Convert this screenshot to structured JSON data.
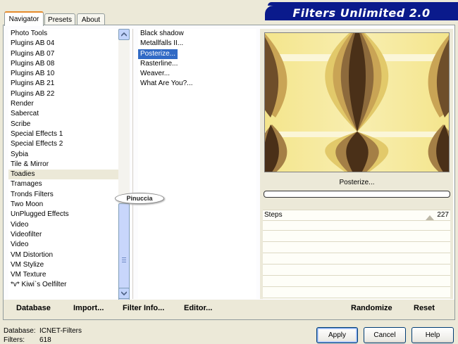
{
  "tabs": [
    "Navigator",
    "Presets",
    "About"
  ],
  "banner_title": "Filters Unlimited 2.0",
  "categories": [
    "Photo Tools",
    "Plugins AB 04",
    "Plugins AB 07",
    "Plugins AB 08",
    "Plugins AB 10",
    "Plugins AB 21",
    "Plugins AB 22",
    "Render",
    "Sabercat",
    "Scribe",
    "Special Effects 1",
    "Special Effects 2",
    "Sybia",
    "Tile & Mirror",
    "Toadies",
    "Tramages",
    "Tronds Filters",
    "Two Moon",
    "UnPlugged Effects",
    "Video",
    "Videofilter",
    "Video",
    "VM Distortion",
    "VM Stylize",
    "VM Texture",
    "*v* Kiwi`s Oelfilter"
  ],
  "selected_category": "Toadies",
  "filters": [
    "Black shadow",
    "Metallfalls II...",
    "Posterize...",
    "Rasterline...",
    "Weaver...",
    "What Are You?..."
  ],
  "selected_filter": "Posterize...",
  "watermark": "Pinuccia",
  "preview_filter_label": "Posterize...",
  "parameters": [
    {
      "name": "Steps",
      "value": "227"
    }
  ],
  "links": {
    "database": "Database",
    "import": "Import...",
    "filter_info": "Filter Info...",
    "editor": "Editor...",
    "randomize": "Randomize",
    "reset": "Reset"
  },
  "buttons": {
    "apply": "Apply",
    "cancel": "Cancel",
    "help": "Help"
  },
  "status": {
    "database_label": "Database:",
    "database_value": "ICNET-Filters",
    "filters_label": "Filters:",
    "filters_value": "618"
  },
  "colors": {
    "banner": "#0a1a8c",
    "selection_blue": "#316ac5",
    "preview_dark": "#4a3018",
    "preview_light": "#f4e58c"
  }
}
